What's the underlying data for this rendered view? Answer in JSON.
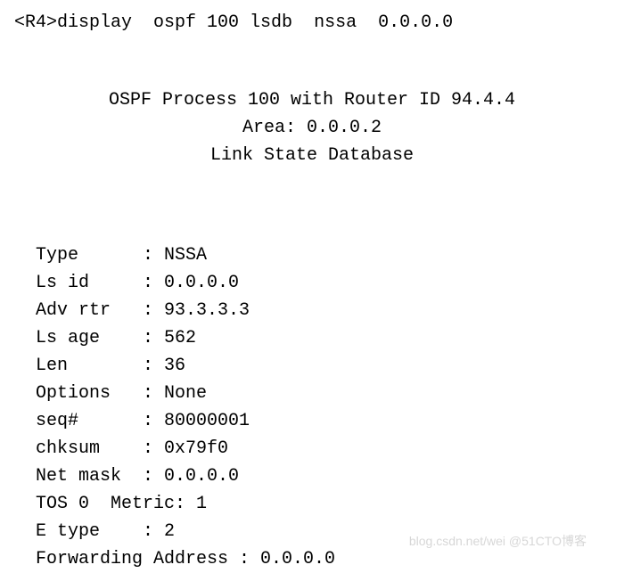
{
  "prompt": "<R4>",
  "command": "display  ospf 100 lsdb  nssa  0.0.0.0",
  "header": {
    "line1": "OSPF Process 100 with Router ID 94.4.4",
    "line2": "Area: 0.0.0.2",
    "line3": "Link State Database"
  },
  "fields": {
    "type_label": "Type      : ",
    "type_value": "NSSA",
    "lsid_label": "Ls id     : ",
    "lsid_value": "0.0.0.0",
    "advrtr_label": "Adv rtr   : ",
    "advrtr_value": "93.3.3.3",
    "lsage_label": "Ls age    : ",
    "lsage_value": "562",
    "len_label": "Len       : ",
    "len_value": "36",
    "options_label": "Options   : ",
    "options_value": "None",
    "seq_label": "seq#      : ",
    "seq_value": "80000001",
    "chksum_label": "chksum    : ",
    "chksum_value": "0x79f0",
    "netmask_label": "Net mask  : ",
    "netmask_value": "0.0.0.0",
    "tos_line": "TOS 0  Metric: 1",
    "etype_label": "E type    : ",
    "etype_value": "2",
    "fwd_label": "Forwarding Address : ",
    "fwd_value": "0.0.0.0"
  },
  "watermark": "blog.csdn.net/wei   @51CTO博客"
}
